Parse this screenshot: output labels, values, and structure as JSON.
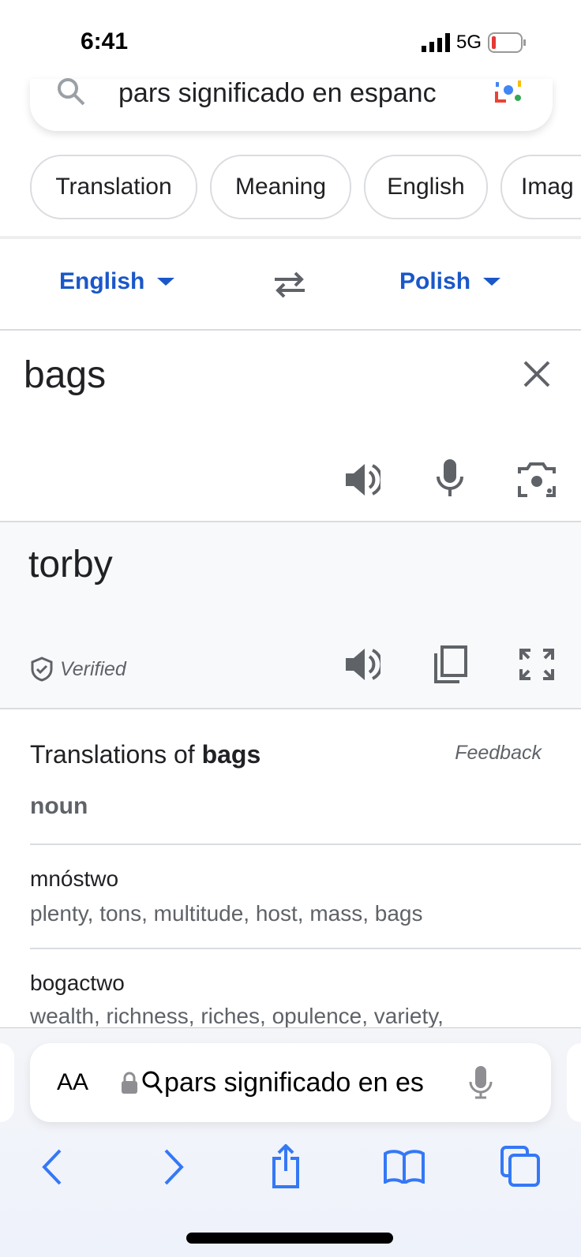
{
  "status": {
    "time": "6:41",
    "network": "5G"
  },
  "search": {
    "query": "pars significado en espanc"
  },
  "chips": [
    "Translation",
    "Meaning",
    "English",
    "Imag"
  ],
  "translate": {
    "source_lang": "English",
    "target_lang": "Polish",
    "source_text": "bags",
    "translated_text": "torby",
    "verified_label": "Verified"
  },
  "translations": {
    "title_prefix": "Translations of ",
    "title_word": "bags",
    "feedback": "Feedback",
    "pos": "noun",
    "entries": [
      {
        "word": "mnóstwo",
        "synonyms": "plenty, tons, multitude, host, mass, bags"
      },
      {
        "word": "bogactwo",
        "synonyms": "wealth, richness, riches, opulence, variety,"
      }
    ]
  },
  "browser": {
    "aa_label": "AA",
    "url": "pars significado en es",
    "accent": "#3478f6"
  }
}
